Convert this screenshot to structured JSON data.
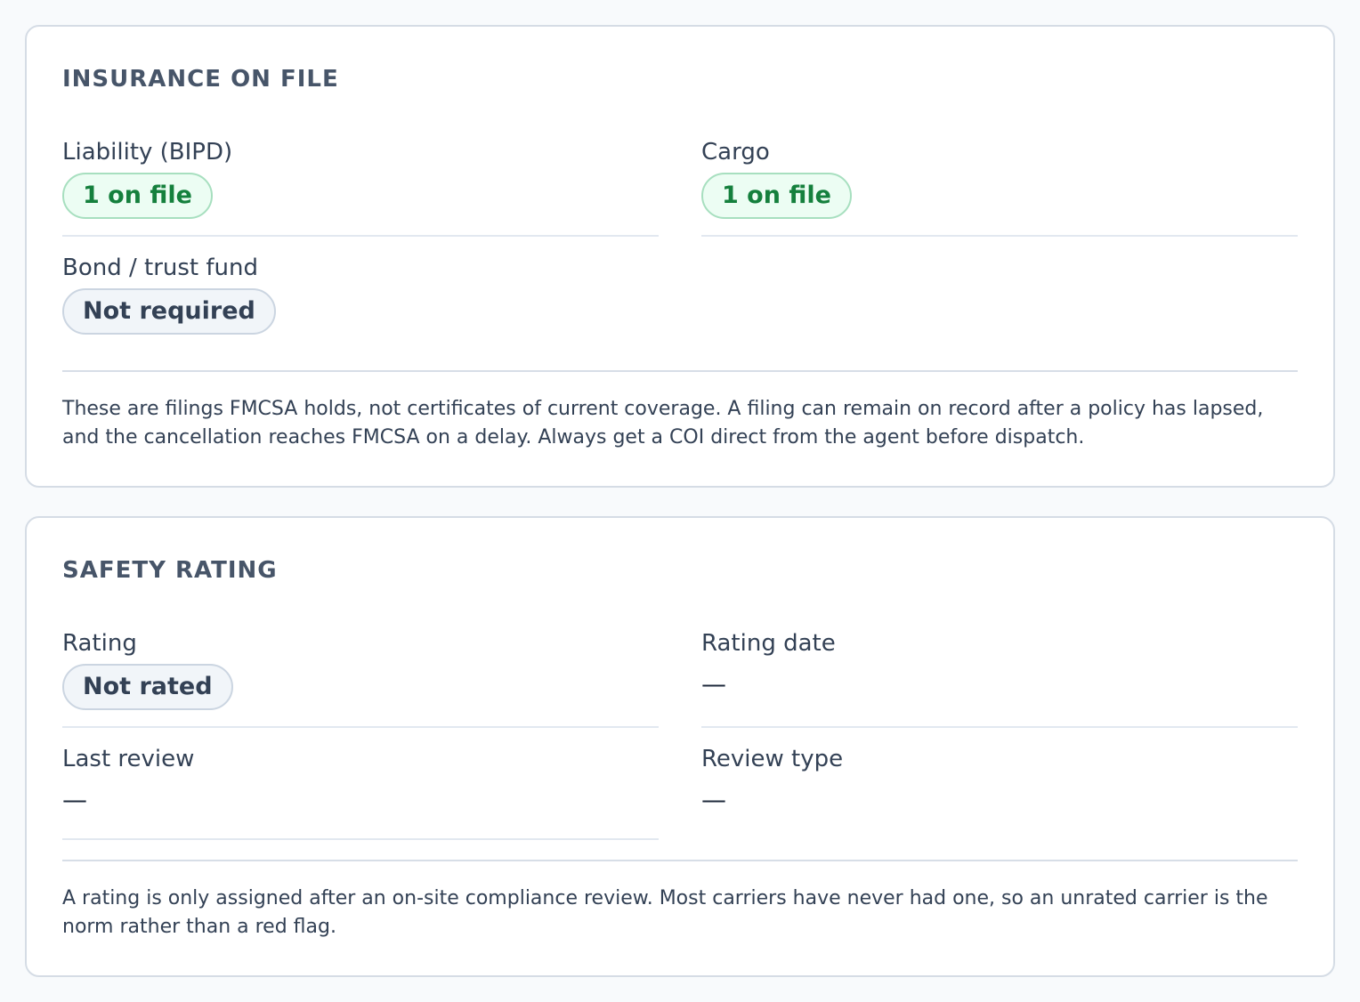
{
  "insurance": {
    "title": "INSURANCE ON FILE",
    "liability": {
      "label": "Liability (BIPD)",
      "value": "1 on file"
    },
    "cargo": {
      "label": "Cargo",
      "value": "1 on file"
    },
    "bond": {
      "label": "Bond / trust fund",
      "value": "Not required"
    },
    "note": "These are filings FMCSA holds, not certificates of current coverage. A filing can remain on record after a policy has lapsed, and the cancellation reaches FMCSA on a delay. Always get a COI direct from the agent before dispatch."
  },
  "safety": {
    "title": "SAFETY RATING",
    "rating": {
      "label": "Rating",
      "value": "Not rated"
    },
    "rating_date": {
      "label": "Rating date",
      "value": "—"
    },
    "last_review": {
      "label": "Last review",
      "value": "—"
    },
    "review_type": {
      "label": "Review type",
      "value": "—"
    },
    "note": "A rating is only assigned after an on-site compliance review. Most carriers have never had one, so an unrated carrier is the norm rather than a red flag."
  },
  "colors": {
    "status_green": "#15803d",
    "status_green_bg": "#ecfdf3",
    "neutral_bg": "#f1f5f9"
  }
}
